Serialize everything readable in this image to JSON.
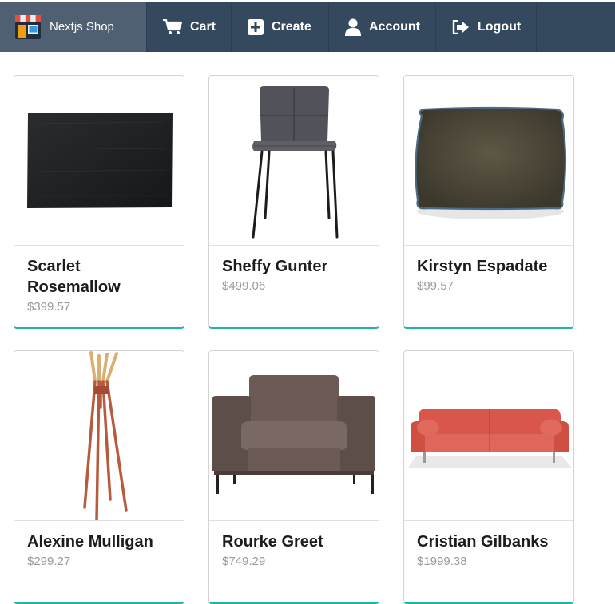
{
  "nav": {
    "brand": {
      "label": "Nextjs Shop",
      "icon": "shop-storefront-icon"
    },
    "items": [
      {
        "label": "Cart",
        "icon": "cart-icon"
      },
      {
        "label": "Create",
        "icon": "plus-square-icon"
      },
      {
        "label": "Account",
        "icon": "user-icon"
      },
      {
        "label": "Logout",
        "icon": "sign-out-icon"
      }
    ]
  },
  "colors": {
    "navbar": "#34495e",
    "brand_bg": "#4f6073",
    "card_accent": "#26b3a7",
    "price": "#9a9a9a"
  },
  "products": [
    {
      "name": "Scarlet Rosemallow",
      "price": "$399.57",
      "image": "black-rug"
    },
    {
      "name": "Sheffy Gunter",
      "price": "$499.06",
      "image": "grey-chair"
    },
    {
      "name": "Kirstyn Espadate",
      "price": "$99.57",
      "image": "brown-pillow"
    },
    {
      "name": "Alexine Mulligan",
      "price": "$299.27",
      "image": "coat-rack"
    },
    {
      "name": "Rourke Greet",
      "price": "$749.29",
      "image": "brown-armchair"
    },
    {
      "name": "Cristian Gilbanks",
      "price": "$1999.38",
      "image": "red-sofa"
    }
  ]
}
